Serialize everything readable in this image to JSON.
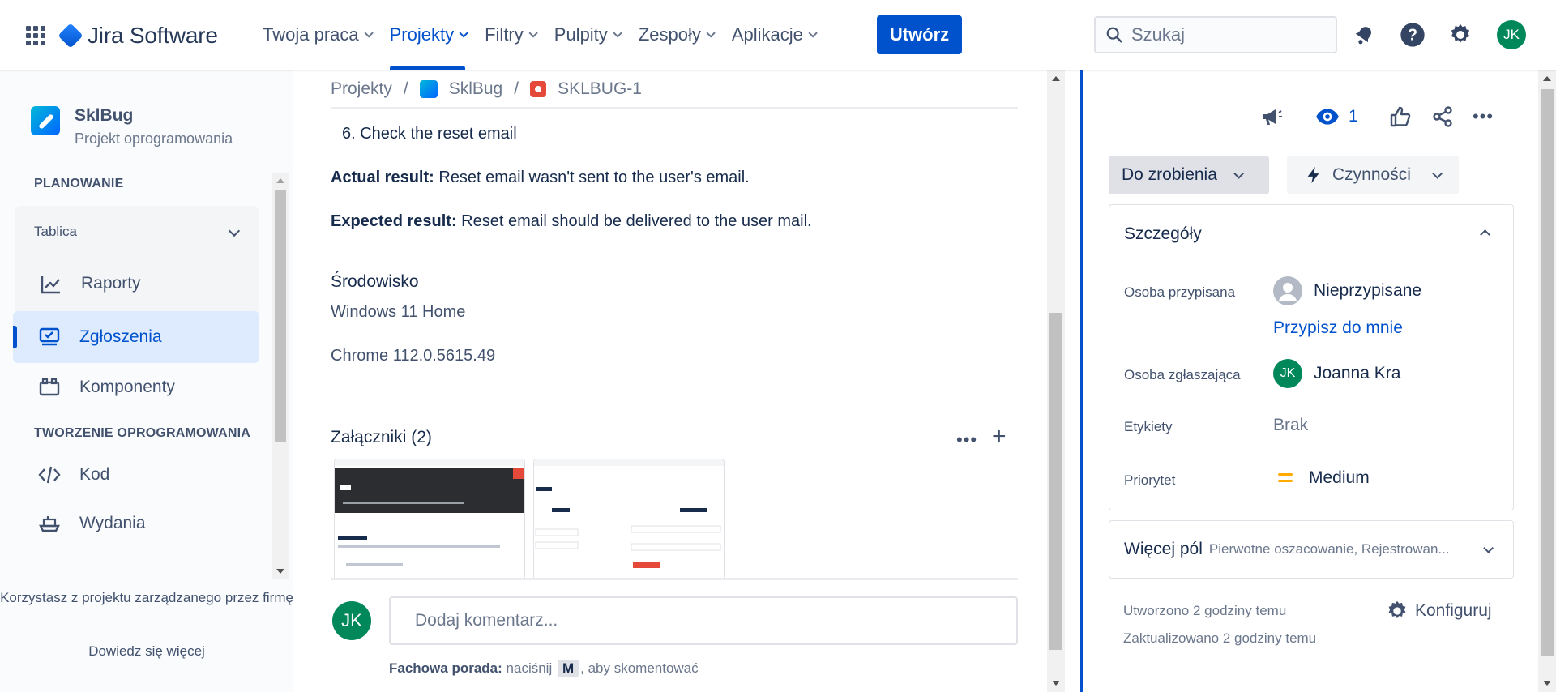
{
  "topbar": {
    "product": "Jira Software",
    "nav": [
      "Twoja praca",
      "Projekty",
      "Filtry",
      "Pulpity",
      "Zespoły",
      "Aplikacje"
    ],
    "active_nav_index": 1,
    "create_label": "Utwórz",
    "search_placeholder": "Szukaj",
    "user_initials": "JK",
    "icons": [
      "apps-grid-icon",
      "notifications-icon",
      "help-icon",
      "settings-icon"
    ]
  },
  "sidebar": {
    "project_name": "SklBug",
    "project_type": "Projekt oprogramowania",
    "section_planning": "PLANOWANIE",
    "board_label": "Tablica",
    "items": [
      {
        "label": "Raporty",
        "icon": "chart-icon"
      },
      {
        "label": "Zgłoszenia",
        "icon": "issues-icon",
        "active": true
      },
      {
        "label": "Komponenty",
        "icon": "components-icon"
      }
    ],
    "section_dev": "TWORZENIE OPROGRAMOWANIA",
    "dev_items": [
      {
        "label": "Kod",
        "icon": "code-icon"
      },
      {
        "label": "Wydania",
        "icon": "ship-icon"
      }
    ],
    "footer_text": "Korzystasz z projektu zarządzanego przez firmę",
    "learn_more": "Dowiedz się więcej"
  },
  "breadcrumb": [
    "Projekty",
    "SklBug",
    "SKLBUG-1"
  ],
  "issue": {
    "step6": "6. Check the reset email",
    "actual_label": "Actual result:",
    "actual_text": " Reset email wasn't sent to the user's email.",
    "expected_label": "Expected result:",
    "expected_text": " Reset email should be delivered to the user mail.",
    "environment_title": "Środowisko",
    "env_os": "Windows 11 Home",
    "env_browser": "Chrome 112.0.5615.49",
    "attachments_title": "Załączniki (2)"
  },
  "comment": {
    "avatar_initials": "JK",
    "placeholder": "Dodaj komentarz...",
    "tip_label": "Fachowa porada:",
    "tip_text_before": " naciśnij ",
    "tip_key": "M",
    "tip_text_after": ", aby skomentować"
  },
  "panel": {
    "watch_count": "1",
    "status": "Do zrobienia",
    "actions": "Czynności",
    "details_title": "Szczegóły",
    "fields": {
      "assignee_label": "Osoba przypisana",
      "assignee_value": "Nieprzypisane",
      "assign_me": "Przypisz do mnie",
      "reporter_label": "Osoba zgłaszająca",
      "reporter_initials": "JK",
      "reporter_value": "Joanna Kra",
      "labels_label": "Etykiety",
      "labels_value": "Brak",
      "priority_label": "Priorytet",
      "priority_value": "Medium"
    },
    "more_fields_title": "Więcej pól",
    "more_fields_summary": "Pierwotne oszacowanie, Rejestrowan...",
    "created": "Utworzono 2 godziny temu",
    "updated": "Zaktualizowano 2 godziny temu",
    "configure": "Konfiguruj"
  },
  "colors": {
    "brand": "#0052cc",
    "avatar": "#00875a",
    "bug": "#e5493a",
    "priority_medium": "#ffab00"
  }
}
